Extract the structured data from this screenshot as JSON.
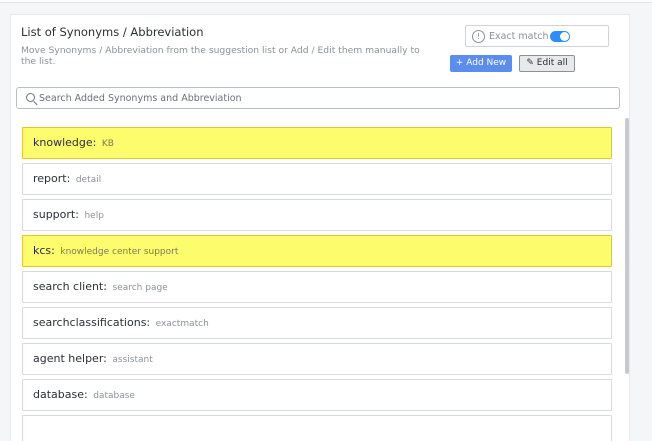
{
  "header": {
    "title": "List of Synonyms / Abbreviation",
    "description": "Move Synonyms / Abbreviation from the suggestion list or Add / Edit them manually to the list."
  },
  "exact_match": {
    "label": "Exact match",
    "enabled": true,
    "info_glyph": "!"
  },
  "buttons": {
    "add_new": "+ Add New",
    "edit_all_icon": "✎",
    "edit_all": "Edit all"
  },
  "search": {
    "placeholder": "Search Added Synonyms and Abbreviation",
    "value": ""
  },
  "items": [
    {
      "key": "knowledge:",
      "value": "KB",
      "highlighted": true
    },
    {
      "key": "report:",
      "value": "detail",
      "highlighted": false
    },
    {
      "key": "support:",
      "value": "help",
      "highlighted": false
    },
    {
      "key": "kcs:",
      "value": "knowledge center support",
      "highlighted": true
    },
    {
      "key": "search client:",
      "value": "search page",
      "highlighted": false
    },
    {
      "key": "searchclassifications:",
      "value": "exactmatch",
      "highlighted": false
    },
    {
      "key": "agent helper:",
      "value": "assistant",
      "highlighted": false
    },
    {
      "key": "database:",
      "value": "database",
      "highlighted": false
    },
    {
      "key": "",
      "value": "",
      "highlighted": false
    }
  ],
  "colors": {
    "highlight": "#fdfc6d",
    "accent": "#5b8def",
    "toggle_on": "#2d8cff"
  }
}
